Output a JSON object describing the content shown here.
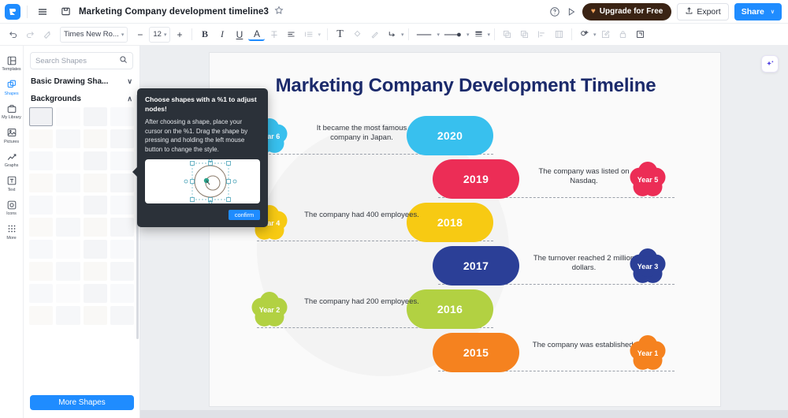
{
  "topbar": {
    "logo_icon": "app-logo-icon",
    "menu_icon": "hamburger-menu-icon",
    "save_icon": "save-icon",
    "doc_title": "Marketing Company development timeline3",
    "star_icon": "star-outline-icon",
    "help_icon": "help-circle-icon",
    "play_icon": "present-play-icon",
    "upgrade_label": "Upgrade for Free",
    "upgrade_icon": "heart-badge-icon",
    "upgrade_bg": "#3a2314",
    "export_label": "Export",
    "export_icon": "export-upload-icon",
    "share_label": "Share",
    "share_bg": "#1f8cff",
    "share_caret": "∨"
  },
  "format_toolbar": {
    "undo_icon": "undo-icon",
    "redo_icon": "redo-icon",
    "format_painter_icon": "format-painter-icon",
    "font_family": "Times New Ro...",
    "font_size": "12",
    "decrease_size_label": "−",
    "increase_size_label": "+",
    "bold_label": "B",
    "italic_label": "I",
    "underline_label": "U",
    "font_color_label": "A",
    "strikethrough_label": "T",
    "align_icon": "align-left-icon",
    "line_spacing_icon": "line-spacing-icon",
    "text_box_label": "T",
    "fill_icon": "fill-color-icon",
    "brush_icon": "brush-icon",
    "connector_icon": "connector-icon",
    "line_style_icon": "line-style-icon",
    "arrow_style_icon": "arrow-style-icon",
    "line_weight_icon": "line-weight-icon",
    "bring_front_icon": "bring-to-front-icon",
    "send_back_icon": "send-to-back-icon",
    "align_objects_icon": "align-objects-icon",
    "distribute_icon": "distribute-icon",
    "effects_icon": "effects-icon",
    "edit_icon": "edit-icon",
    "lock_icon": "lock-icon",
    "crop_icon": "crop-icon"
  },
  "rail": {
    "items": [
      {
        "label": "Templates",
        "icon": "templates-icon",
        "active": false
      },
      {
        "label": "Shapes",
        "icon": "shapes-icon",
        "active": true
      },
      {
        "label": "My Library",
        "icon": "my-library-icon",
        "active": false
      },
      {
        "label": "Pictures",
        "icon": "pictures-icon",
        "active": false
      },
      {
        "label": "Graphs",
        "icon": "graphs-icon",
        "active": false
      },
      {
        "label": "Text",
        "icon": "text-icon",
        "active": false
      },
      {
        "label": "Icons",
        "icon": "icons-icon",
        "active": false
      },
      {
        "label": "More",
        "icon": "more-grid-icon",
        "active": false
      }
    ]
  },
  "shapes_panel": {
    "search_placeholder": "Search Shapes",
    "search_icon": "search-icon",
    "sections": [
      {
        "label": "Basic Drawing Sha...",
        "expanded": false,
        "chevron": "∨"
      },
      {
        "label": "Backgrounds",
        "expanded": true,
        "chevron": "∧"
      }
    ],
    "more_shapes_label": "More Shapes",
    "thumb_count": 40,
    "selected_thumb_index": 0
  },
  "tooltip": {
    "title": "Choose shapes with a %1 to adjust nodes!",
    "body": "After choosing a shape, place your cursor on the %1. Drag the shape by pressing and holding the left mouse button to change the style.",
    "confirm_label": "confirm"
  },
  "canvas": {
    "ai_icon": "ai-sparkle-icon",
    "title": "Marketing Company Development Timeline",
    "title_color": "#1b2a6b"
  },
  "chart_data": {
    "type": "timeline",
    "title": "Marketing Company Development Timeline",
    "items": [
      {
        "year": "2020",
        "color": "#38c0ee",
        "badge": "Year 6",
        "description": "It became the most famous company in Japan.",
        "side": "left"
      },
      {
        "year": "2019",
        "color": "#ec2d56",
        "badge": "Year 5",
        "description": "The company was listed on Nasdaq.",
        "side": "right"
      },
      {
        "year": "2018",
        "color": "#f7ca13",
        "badge": "Year 4",
        "description": "The company had 400 employees.",
        "side": "left"
      },
      {
        "year": "2017",
        "color": "#2b3f97",
        "badge": "Year 3",
        "description": "The turnover  reached 2 million dollars.",
        "side": "right"
      },
      {
        "year": "2016",
        "color": "#b2d142",
        "badge": "Year 2",
        "description": "The company had 200 employees.",
        "side": "left"
      },
      {
        "year": "2015",
        "color": "#f5821f",
        "badge": "Year 1",
        "description": "The company was established.",
        "side": "right"
      }
    ]
  }
}
